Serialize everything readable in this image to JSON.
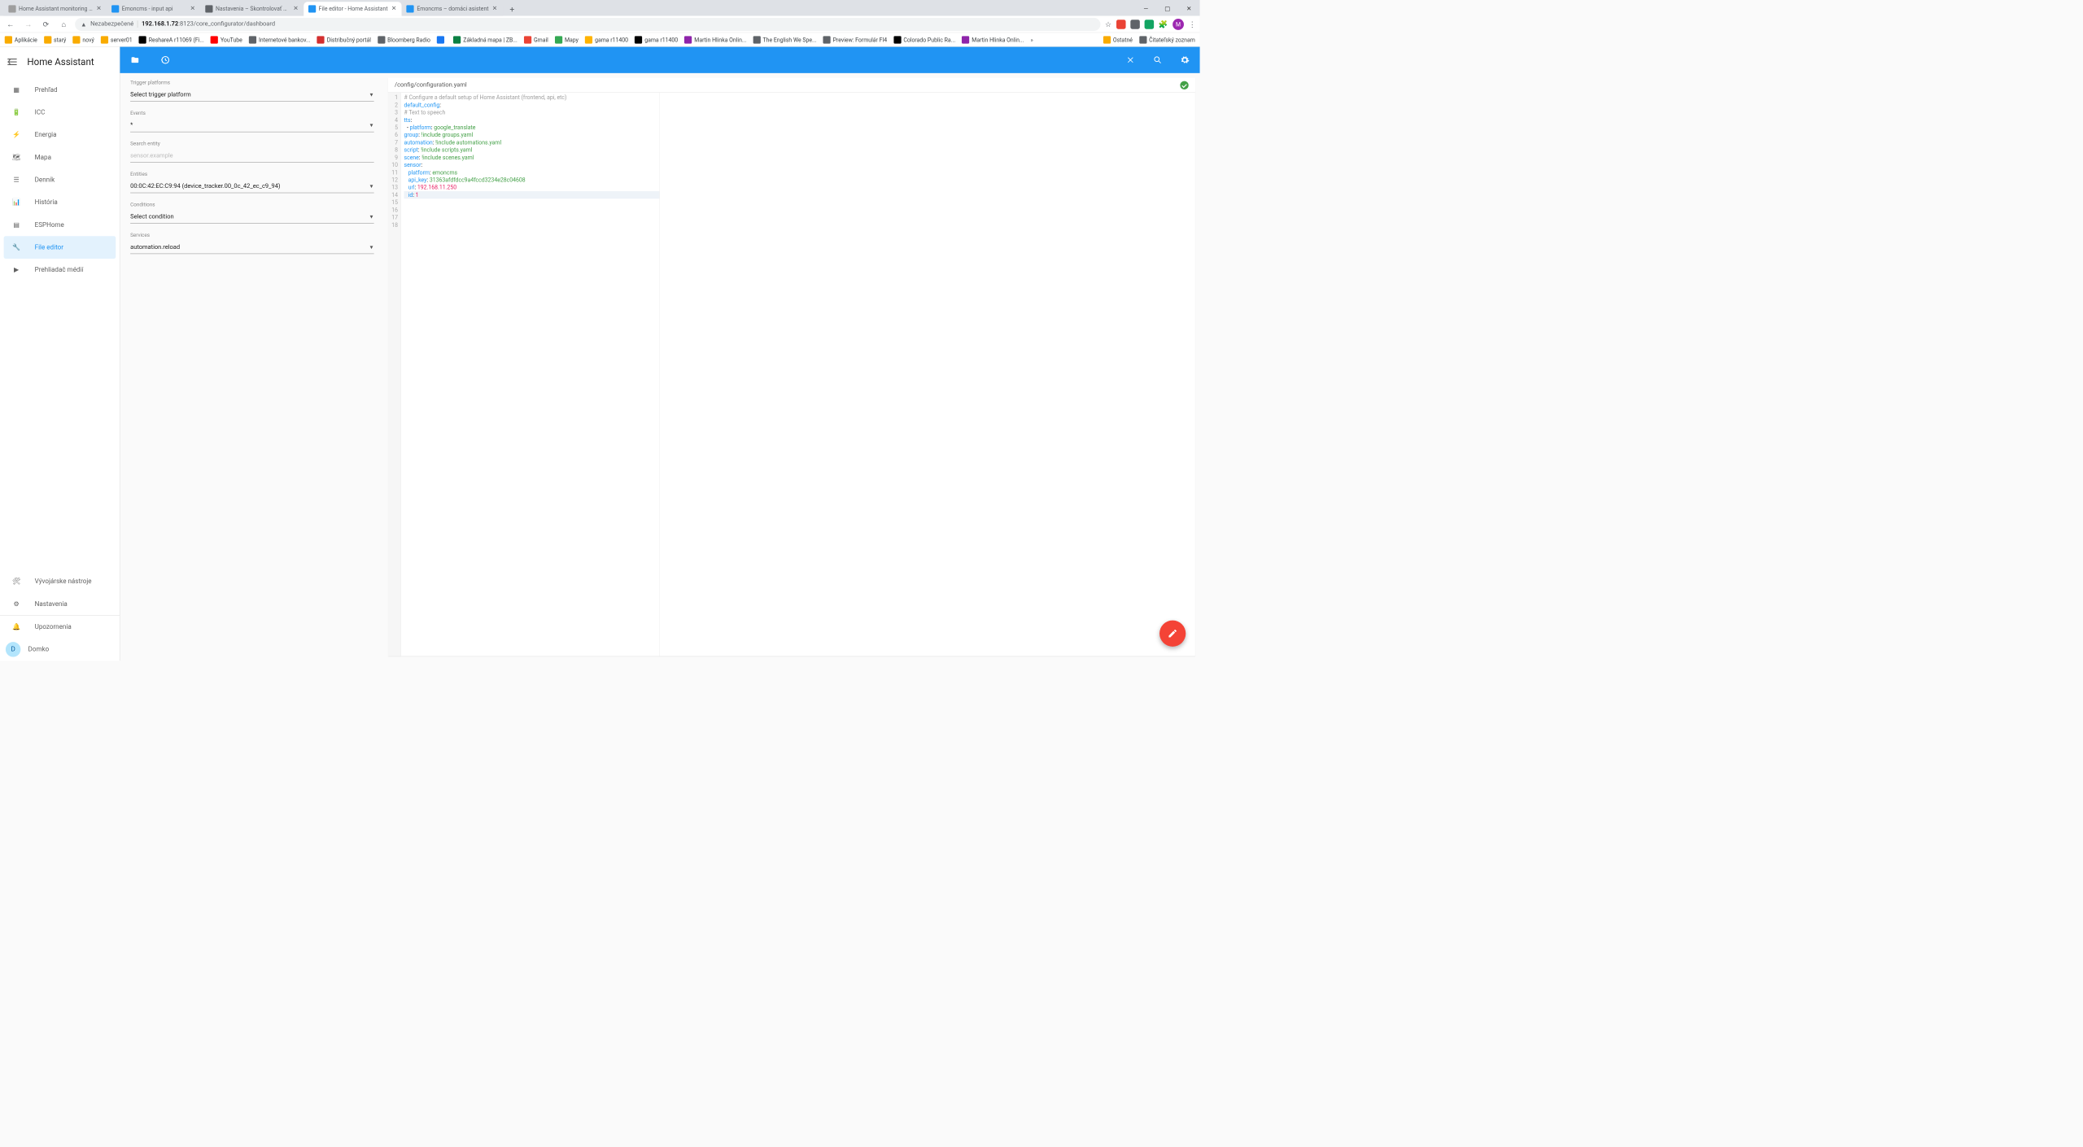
{
  "browser": {
    "tabs": [
      {
        "title": "Home Assistant monitoring FVE",
        "favicon": "#9e9e9e",
        "active": false
      },
      {
        "title": "Emoncms - input api",
        "favicon": "#2094f3",
        "active": false
      },
      {
        "title": "Nastavenia – Skontrolovať heslá",
        "favicon": "#5f6368",
        "active": false
      },
      {
        "title": "File editor - Home Assistant",
        "favicon": "#2094f3",
        "active": true
      },
      {
        "title": "Emoncms – domáci asistent",
        "favicon": "#2094f3",
        "active": false
      }
    ],
    "insecure_label": "Nezabezpečené",
    "url_host": "192.168.1.72",
    "url_path": ":8123/core_configurator/dashboard",
    "avatar_letter": "M",
    "bookmarks_left": [
      {
        "label": "Aplikácie",
        "color": "#f9ab00"
      },
      {
        "label": "starý",
        "color": "#f9ab00"
      },
      {
        "label": "nový",
        "color": "#f9ab00"
      },
      {
        "label": "server01",
        "color": "#f9ab00"
      },
      {
        "label": "ReshareA r11069 (Fi...",
        "color": "#000"
      },
      {
        "label": "YouTube",
        "color": "#ff0000"
      },
      {
        "label": "Internetové bankov...",
        "color": "#5f6368"
      },
      {
        "label": "Distribučný portál",
        "color": "#d32f2f"
      },
      {
        "label": "Bloomberg Radio",
        "color": "#5f6368"
      },
      {
        "label": "",
        "color": "#1877f2"
      },
      {
        "label": "Základná mapa | ZB...",
        "color": "#0b8043"
      },
      {
        "label": "Gmail",
        "color": "#ea4335"
      },
      {
        "label": "Mapy",
        "color": "#34a853"
      },
      {
        "label": "gama r11400",
        "color": "#ffb300"
      },
      {
        "label": "gama r11400",
        "color": "#000"
      },
      {
        "label": "Martin Hlinka Onlin...",
        "color": "#8e24aa"
      },
      {
        "label": "The English We Spe...",
        "color": "#5f6368"
      },
      {
        "label": "Preview: Formulár FI4",
        "color": "#5f6368"
      },
      {
        "label": "Colorado Public Ra...",
        "color": "#000"
      },
      {
        "label": "Martin Hlinka Onlin...",
        "color": "#8e24aa"
      }
    ],
    "bookmarks_right": [
      {
        "label": "Ostatné",
        "color": "#f9ab00"
      },
      {
        "label": "Čitateľský zoznam",
        "color": "#5f6368"
      }
    ]
  },
  "sidebar": {
    "brand": "Home Assistant",
    "items": [
      {
        "label": "Prehľad",
        "icon": "dashboard"
      },
      {
        "label": "ICC",
        "icon": "battery"
      },
      {
        "label": "Energia",
        "icon": "bolt"
      },
      {
        "label": "Mapa",
        "icon": "map"
      },
      {
        "label": "Denník",
        "icon": "list"
      },
      {
        "label": "História",
        "icon": "chart"
      },
      {
        "label": "ESPHome",
        "icon": "chip"
      },
      {
        "label": "File editor",
        "icon": "wrench",
        "active": true
      },
      {
        "label": "Prehliadač médií",
        "icon": "media"
      }
    ],
    "bottom": [
      {
        "label": "Vývojárske nástroje",
        "icon": "hammer"
      },
      {
        "label": "Nastavenia",
        "icon": "gear"
      }
    ],
    "notif": {
      "label": "Upozornenia",
      "icon": "bell"
    },
    "user": {
      "label": "Domko",
      "letter": "D"
    }
  },
  "left_panel": {
    "f1_label": "Trigger platforms",
    "f1_value": "Select trigger platform",
    "f2_label": "Events",
    "f2_value": "*",
    "f3_label": "Search entity",
    "f3_placeholder": "sensor.example",
    "f4_label": "Entities",
    "f4_value": "00:0C:42:EC:C9:94 (device_tracker.00_0c_42_ec_c9_94)",
    "f5_label": "Conditions",
    "f5_value": "Select condition",
    "f6_label": "Services",
    "f6_value": "automation.reload"
  },
  "editor": {
    "file": "/config/configuration.yaml",
    "gutter": [
      "1",
      "2",
      "3",
      "4",
      "5",
      "6",
      "7",
      "8",
      "9",
      "10",
      "11",
      "12",
      "13",
      "14",
      "15",
      "16",
      "17",
      "18"
    ],
    "lines": [
      {
        "t": ""
      },
      {
        "t": "# Configure a default setup of Home Assistant (frontend, api, etc)",
        "cls": "c"
      },
      {
        "html": "<span class='k'>default_config</span>:"
      },
      {
        "t": ""
      },
      {
        "t": "# Text to speech",
        "cls": "c"
      },
      {
        "html": "<span class='k'>tts</span>:",
        "fold": true
      },
      {
        "html": "  - <span class='k'>platform</span>: <span class='s'>google_translate</span>"
      },
      {
        "t": ""
      },
      {
        "html": "<span class='k'>group</span>: <span class='s'>!include groups.yaml</span>"
      },
      {
        "html": "<span class='k'>automation</span>: <span class='s'>!include automations.yaml</span>"
      },
      {
        "html": "<span class='k'>script</span>: <span class='s'>!include scripts.yaml</span>"
      },
      {
        "html": "<span class='k'>scene</span>: <span class='s'>!include scenes.yaml</span>"
      },
      {
        "t": ""
      },
      {
        "html": "<span class='k'>sensor</span>:",
        "fold": true
      },
      {
        "html": "   <span class='k'>platform</span>: <span class='s'>emoncms</span>"
      },
      {
        "html": "   <span class='k'>api_key</span>: <span class='s'>31363afdfdcc9a4fccd3234e28c04608</span>"
      },
      {
        "html": "   <span class='k'>url</span>: <span class='n'>192.168.11.250</span>"
      },
      {
        "html": "   <span class='k'>id</span>: <span class='n'>1</span>",
        "hl": true
      }
    ]
  }
}
